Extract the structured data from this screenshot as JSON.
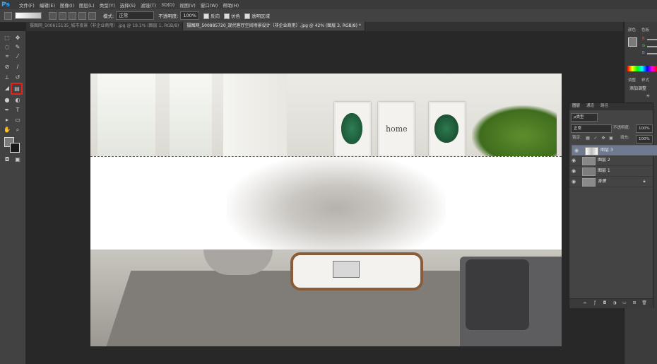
{
  "app": {
    "logo": "Ps"
  },
  "menu": [
    "文件(F)",
    "编辑(E)",
    "图像(I)",
    "图层(L)",
    "类型(Y)",
    "选择(S)",
    "滤镜(T)",
    "3D(D)",
    "视图(V)",
    "窗口(W)",
    "帮助(H)"
  ],
  "options": {
    "mode_label": "模式:",
    "mode_value": "正常",
    "opacity_label": "不透明度:",
    "opacity_value": "100%",
    "reverse_label": "反向",
    "dither_label": "仿色",
    "transparency_label": "透明区域"
  },
  "tabs": [
    {
      "label": "摄图网_500615135_城市夜景（非企业商用）.jpg @ 19.1% (图层 1, RGB/8)",
      "active": false
    },
    {
      "label": "摄图网_500885720_现代客厅空间场景设计（非企业商用）.jpg @ 42% (图层 3, RGB/8) *",
      "active": true
    }
  ],
  "right_panels": {
    "color_tabs": [
      "颜色",
      "色板"
    ],
    "channel_labels": [
      "R",
      "G",
      "B"
    ],
    "adjust_tabs": [
      "调整",
      "样式"
    ],
    "adjust_title": "添加调整"
  },
  "layers_panel": {
    "tabs": [
      "图层",
      "通道",
      "路径"
    ],
    "kind_label": "ρ类型",
    "blend_mode": "正常",
    "opacity_label": "不透明度:",
    "opacity_value": "100%",
    "lock_label": "锁定:",
    "fill_label": "填充:",
    "fill_value": "100%",
    "layers": [
      {
        "name": "图层 3",
        "selected": true
      },
      {
        "name": "图层 2",
        "selected": false
      },
      {
        "name": "图层 1",
        "selected": false
      },
      {
        "name": "背景",
        "selected": false,
        "locked": true
      }
    ]
  },
  "doc_image": {
    "poster_text": "home"
  },
  "colors": {
    "highlight": "#e4231f",
    "ps_blue": "#31a8ff",
    "layer_selected": "#6f7a91"
  }
}
